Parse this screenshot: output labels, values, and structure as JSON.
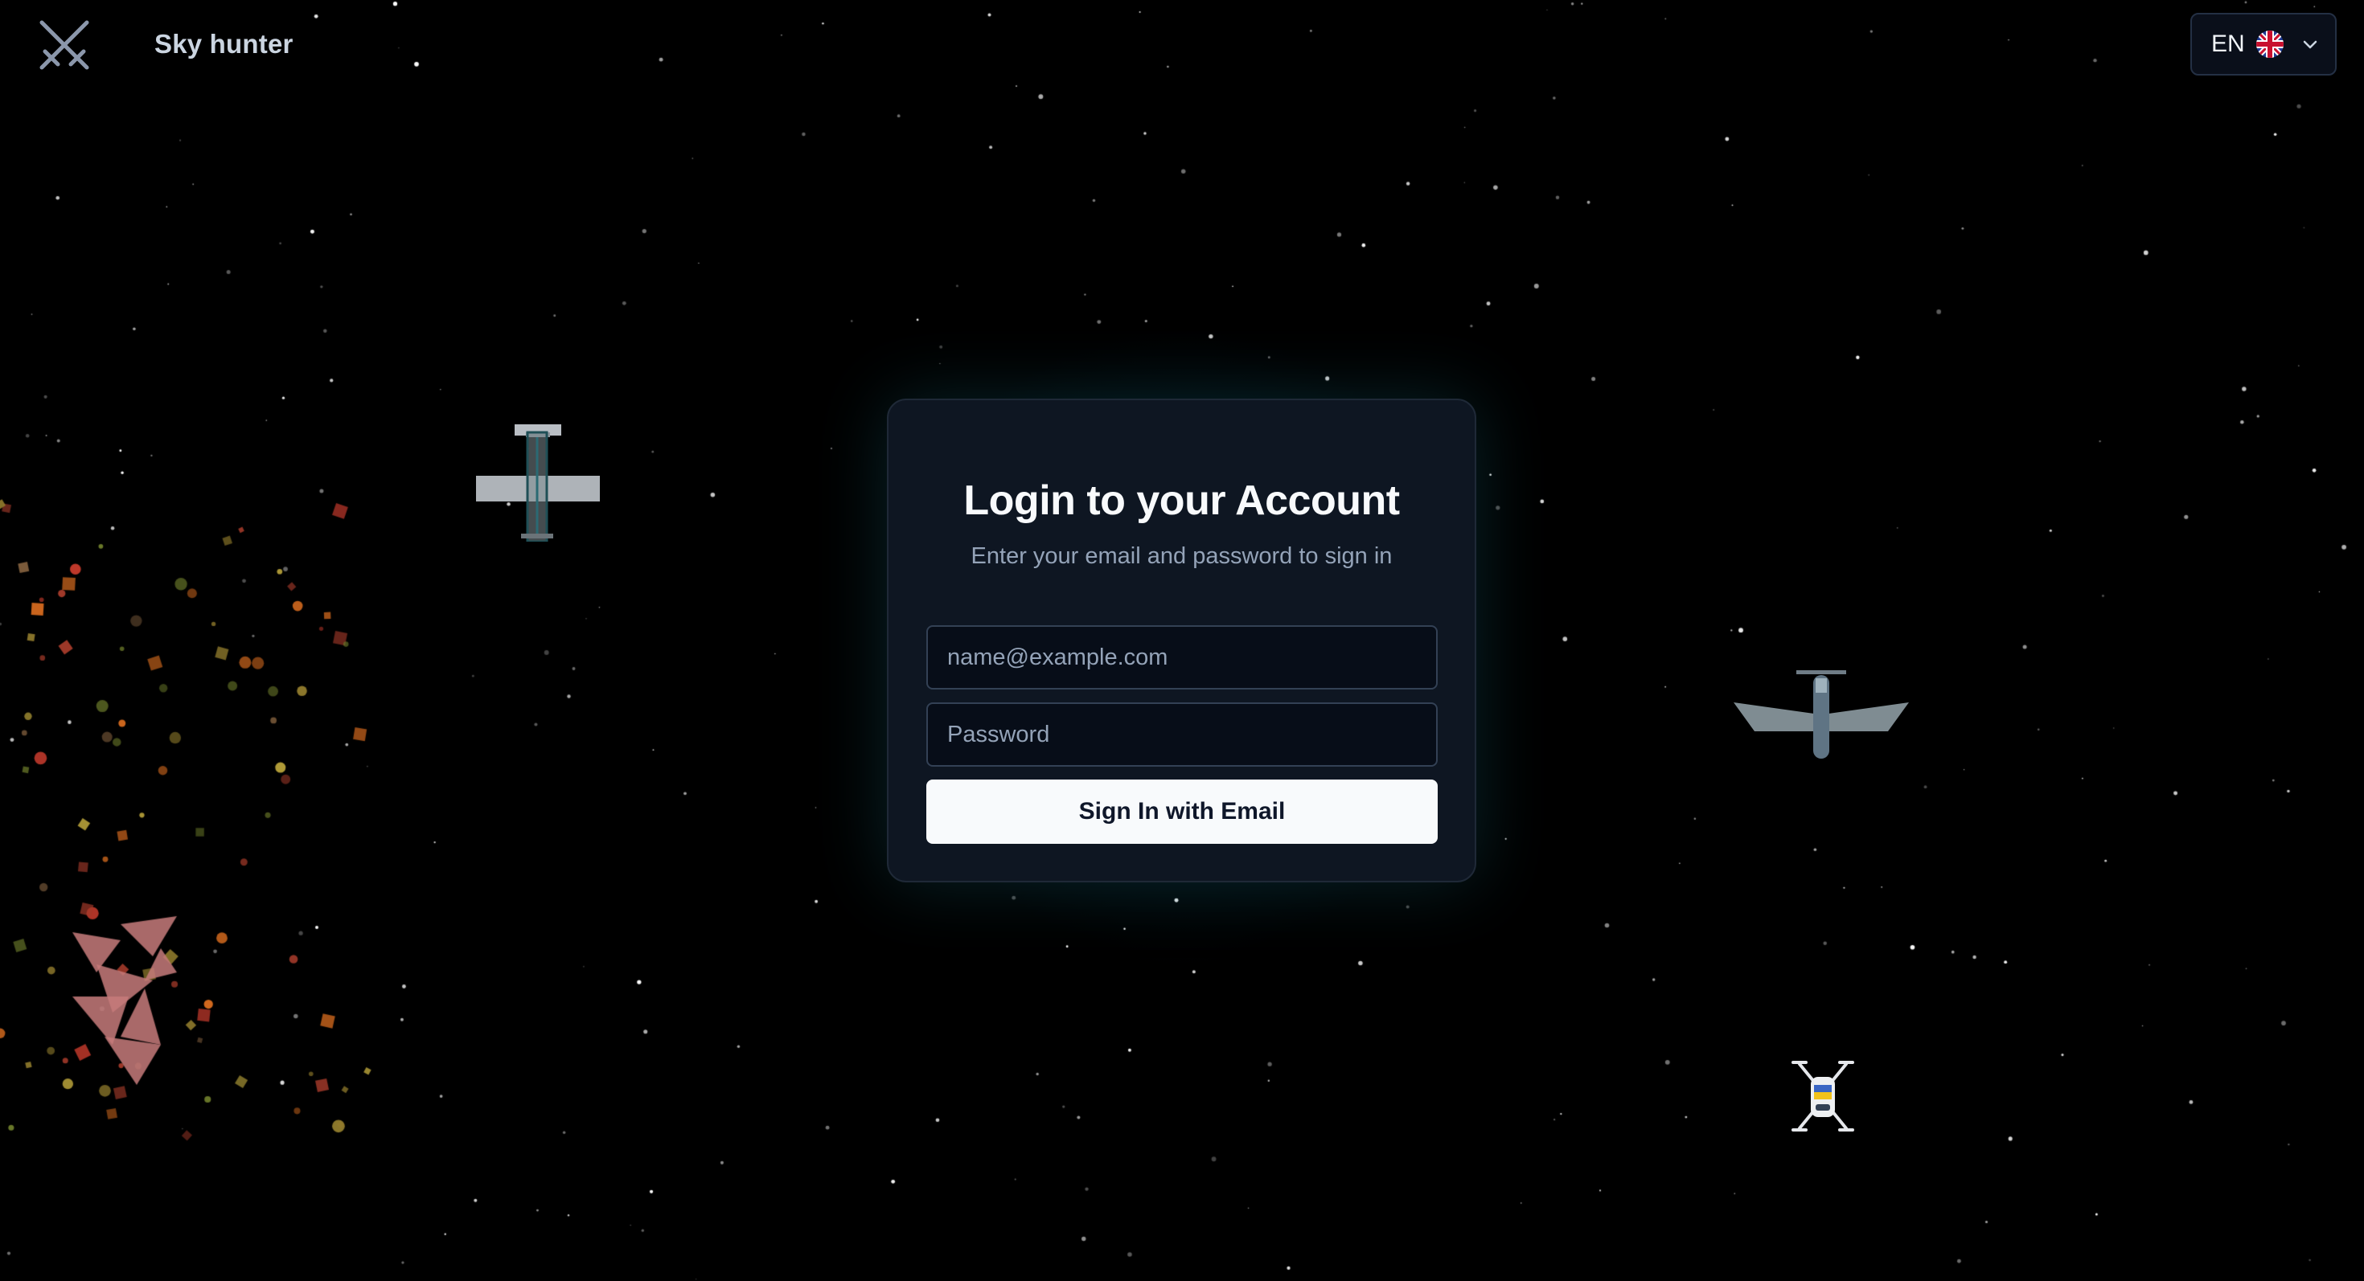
{
  "header": {
    "brand": "Sky hunter",
    "logo_icon": "crossed-swords-icon",
    "language": {
      "code": "EN",
      "flag_icon": "uk-flag-icon",
      "dropdown_icon": "chevron-down-icon"
    }
  },
  "login": {
    "title": "Login to your Account",
    "subtitle": "Enter your email and password to sign in",
    "email_placeholder": "name@example.com",
    "email_value": "",
    "password_placeholder": "Password",
    "password_value": "",
    "submit_label": "Sign In with Email"
  },
  "scene": {
    "objects": [
      "biplane",
      "jet-plane",
      "quadcopter-drone",
      "explosion-debris"
    ]
  },
  "colors": {
    "background": "#000000",
    "card": "#0e1622",
    "glow": "#14788c",
    "button": "#f8fafc"
  }
}
